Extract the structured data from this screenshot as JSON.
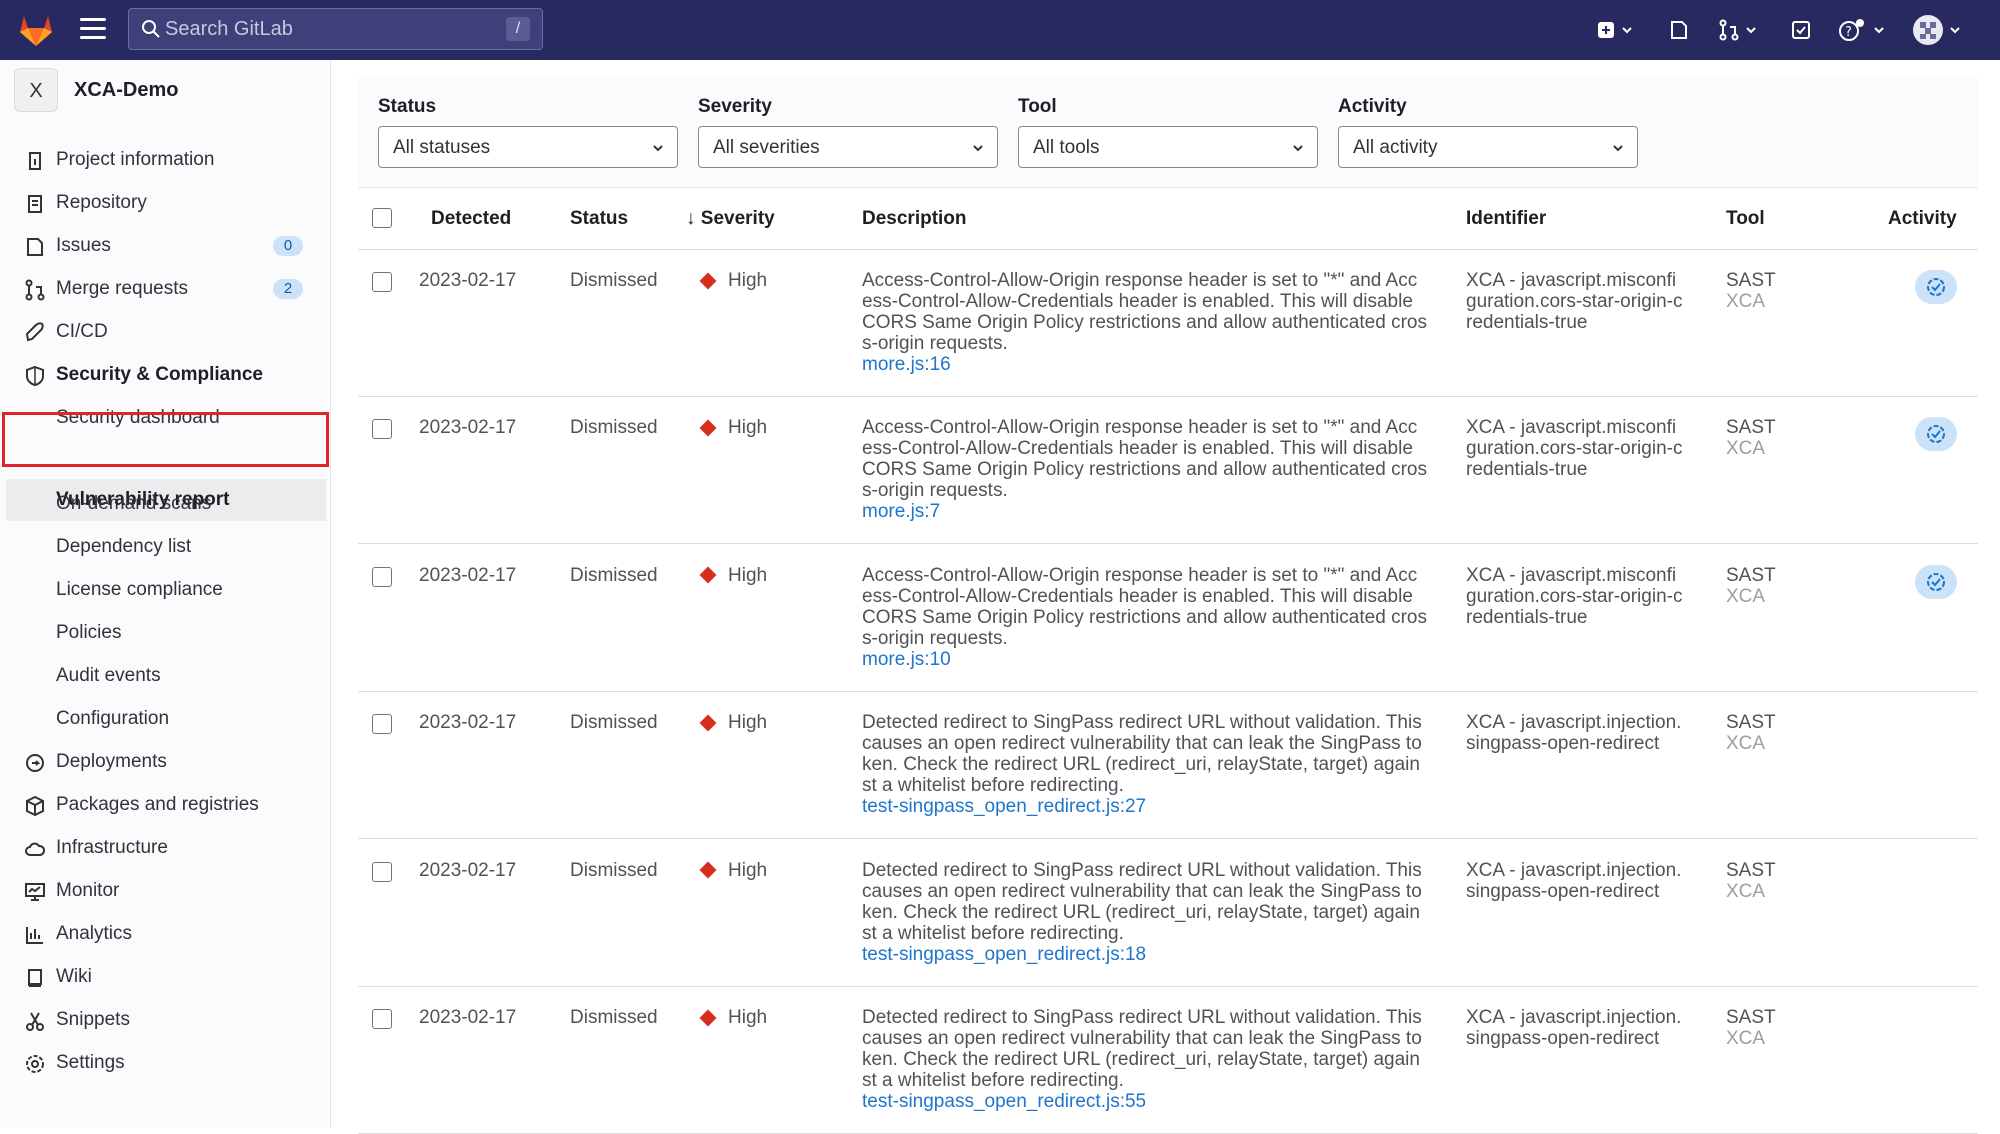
{
  "topbar": {
    "search_placeholder": "Search GitLab",
    "search_shortcut": "/"
  },
  "project": {
    "avatar_letter": "X",
    "name": "XCA-Demo"
  },
  "sidebar": {
    "items": [
      {
        "label": "Project information",
        "icon": "info-icon"
      },
      {
        "label": "Repository",
        "icon": "doc-icon"
      },
      {
        "label": "Issues",
        "icon": "issues-icon",
        "badge": "0"
      },
      {
        "label": "Merge requests",
        "icon": "merge-request-icon",
        "badge": "2"
      },
      {
        "label": "CI/CD",
        "icon": "rocket-icon"
      },
      {
        "label": "Security & Compliance",
        "icon": "shield-icon"
      },
      {
        "label": "Security dashboard"
      },
      {
        "label": "Vulnerability report"
      },
      {
        "label": "On-demand scans"
      },
      {
        "label": "Dependency list"
      },
      {
        "label": "License compliance"
      },
      {
        "label": "Policies"
      },
      {
        "label": "Audit events"
      },
      {
        "label": "Configuration"
      },
      {
        "label": "Deployments",
        "icon": "deployments-icon"
      },
      {
        "label": "Packages and registries",
        "icon": "package-icon"
      },
      {
        "label": "Infrastructure",
        "icon": "cloud-icon"
      },
      {
        "label": "Monitor",
        "icon": "monitor-icon"
      },
      {
        "label": "Analytics",
        "icon": "chart-icon"
      },
      {
        "label": "Wiki",
        "icon": "book-icon"
      },
      {
        "label": "Snippets",
        "icon": "scissors-icon"
      },
      {
        "label": "Settings",
        "icon": "gear-icon"
      }
    ]
  },
  "filters": [
    {
      "label": "Status",
      "value": "All statuses"
    },
    {
      "label": "Severity",
      "value": "All severities"
    },
    {
      "label": "Tool",
      "value": "All tools"
    },
    {
      "label": "Activity",
      "value": "All activity"
    }
  ],
  "table": {
    "headers": {
      "detected": "Detected",
      "status": "Status",
      "severity": "Severity",
      "description": "Description",
      "identifier": "Identifier",
      "tool": "Tool",
      "activity": "Activity"
    },
    "rows": [
      {
        "detected": "2023-02-17",
        "status": "Dismissed",
        "severity": "High",
        "description": "Access-Control-Allow-Origin response header is set to \"*\" and Access-Control-Allow-Credentials header is enabled. This will disable CORS Same Origin Policy restrictions and allow authenticated cross-origin requests.",
        "location": "more.js:16",
        "identifier": "XCA - javascript.misconfiguration.cors-star-origin-credentials-true",
        "tool": "SAST",
        "tool_vendor": "XCA",
        "activity": true
      },
      {
        "detected": "2023-02-17",
        "status": "Dismissed",
        "severity": "High",
        "description": "Access-Control-Allow-Origin response header is set to \"*\" and Access-Control-Allow-Credentials header is enabled. This will disable CORS Same Origin Policy restrictions and allow authenticated cross-origin requests.",
        "location": "more.js:7",
        "identifier": "XCA - javascript.misconfiguration.cors-star-origin-credentials-true",
        "tool": "SAST",
        "tool_vendor": "XCA",
        "activity": true
      },
      {
        "detected": "2023-02-17",
        "status": "Dismissed",
        "severity": "High",
        "description": "Access-Control-Allow-Origin response header is set to \"*\" and Access-Control-Allow-Credentials header is enabled. This will disable CORS Same Origin Policy restrictions and allow authenticated cross-origin requests.",
        "location": "more.js:10",
        "identifier": "XCA - javascript.misconfiguration.cors-star-origin-credentials-true",
        "tool": "SAST",
        "tool_vendor": "XCA",
        "activity": true
      },
      {
        "detected": "2023-02-17",
        "status": "Dismissed",
        "severity": "High",
        "description": "Detected redirect to SingPass redirect URL without validation. This causes an open redirect vulnerability that can leak the SingPass token. Check the redirect URL (redirect_uri, relayState, target) against a whitelist before redirecting.",
        "location": "test-singpass_open_redirect.js:27",
        "identifier": "XCA - javascript.injection.singpass-open-redirect",
        "tool": "SAST",
        "tool_vendor": "XCA",
        "activity": false
      },
      {
        "detected": "2023-02-17",
        "status": "Dismissed",
        "severity": "High",
        "description": "Detected redirect to SingPass redirect URL without validation. This causes an open redirect vulnerability that can leak the SingPass token. Check the redirect URL (redirect_uri, relayState, target) against a whitelist before redirecting.",
        "location": "test-singpass_open_redirect.js:18",
        "identifier": "XCA - javascript.injection.singpass-open-redirect",
        "tool": "SAST",
        "tool_vendor": "XCA",
        "activity": false
      },
      {
        "detected": "2023-02-17",
        "status": "Dismissed",
        "severity": "High",
        "description": "Detected redirect to SingPass redirect URL without validation. This causes an open redirect vulnerability that can leak the SingPass token. Check the redirect URL (redirect_uri, relayState, target) against a whitelist before redirecting.",
        "location": "test-singpass_open_redirect.js:55",
        "identifier": "XCA - javascript.injection.singpass-open-redirect",
        "tool": "SAST",
        "tool_vendor": "XCA",
        "activity": false
      }
    ]
  }
}
